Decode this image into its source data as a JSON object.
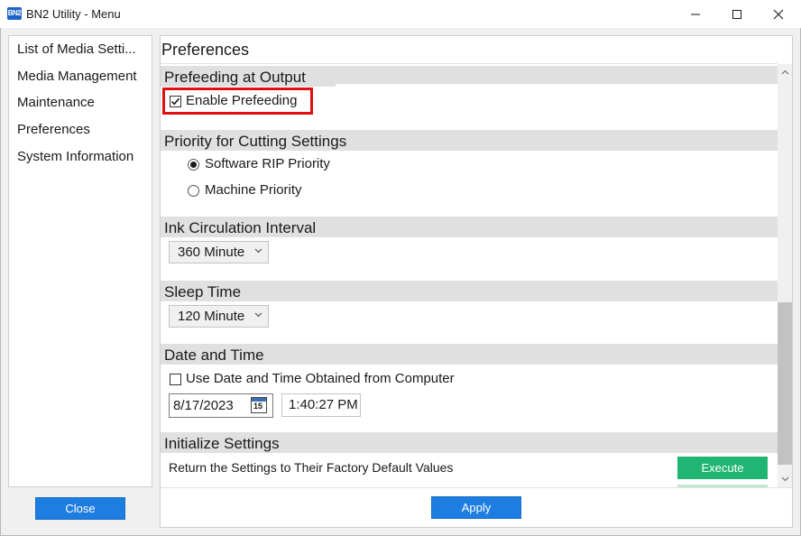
{
  "window": {
    "title": "BN2 Utility - Menu",
    "icon_text": "BN2"
  },
  "sidebar": {
    "items": [
      {
        "label": "List of Media Setti..."
      },
      {
        "label": "Media Management"
      },
      {
        "label": "Maintenance"
      },
      {
        "label": "Preferences"
      },
      {
        "label": "System Information"
      }
    ],
    "close_label": "Close"
  },
  "main": {
    "title": "Preferences",
    "apply_label": "Apply",
    "sections": {
      "prefeeding": {
        "title": "Prefeeding at Output",
        "enable_label": "Enable Prefeeding",
        "enable_checked": true
      },
      "priority": {
        "title": "Priority for Cutting Settings",
        "options": [
          {
            "label": "Software RIP Priority",
            "selected": true
          },
          {
            "label": "Machine Priority",
            "selected": false
          }
        ]
      },
      "ink": {
        "title": "Ink Circulation Interval",
        "value": "360 Minute"
      },
      "sleep": {
        "title": "Sleep Time",
        "value": "120 Minute"
      },
      "datetime": {
        "title": "Date and Time",
        "use_computer_label": "Use Date and Time Obtained from Computer",
        "use_computer_checked": false,
        "date": "8/17/2023",
        "calendar_day": "15",
        "time": "1:40:27 PM"
      },
      "initialize": {
        "title": "Initialize Settings",
        "description": "Return the Settings to Their Factory Default Values",
        "execute_label": "Execute"
      }
    }
  },
  "colors": {
    "accent_blue": "#1e7de0",
    "execute_green": "#21b573",
    "highlight_red": "#e01010",
    "section_band": "#e0e0e0"
  }
}
